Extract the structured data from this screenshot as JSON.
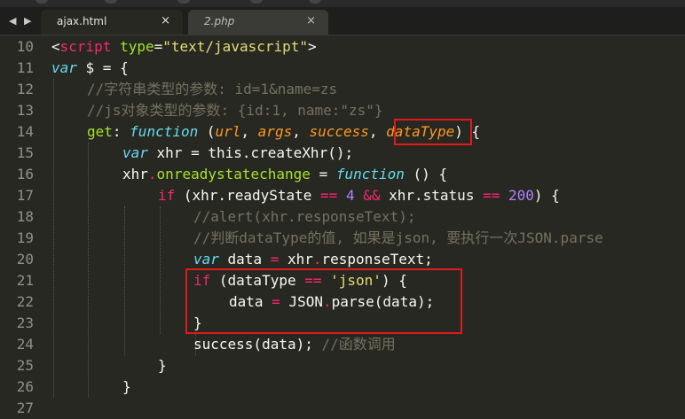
{
  "nav": {
    "back_icon": "◀",
    "forward_icon": "▶"
  },
  "tabs": [
    {
      "label": "ajax.html",
      "close": "×",
      "active": true
    },
    {
      "label": "2.php",
      "close": "×",
      "active": false
    }
  ],
  "line_numbers": [
    "10",
    "11",
    "12",
    "13",
    "14",
    "15",
    "16",
    "17",
    "18",
    "19",
    "20",
    "21",
    "22",
    "23",
    "24",
    "25",
    "26",
    "27"
  ],
  "code": {
    "l10": {
      "p1": "<",
      "tag": "script",
      "attr": "type",
      "p2": "=",
      "val": "\"text/javascript\"",
      "p3": ">"
    },
    "l11": {
      "var": "var",
      "rest": " $ = {"
    },
    "l12": {
      "comment": "//字符串类型的参数: id=1&name=zs"
    },
    "l13": {
      "comment": "//js对象类型的参数: {id:1, name:\"zs\"}"
    },
    "l14": {
      "key": "get",
      "colon": ": ",
      "func": "function",
      "open": " (",
      "a1": "url",
      "c1": ", ",
      "a2": "args",
      "c2": ", ",
      "a3": "success",
      "c3": ", ",
      "a4": "dataType",
      "close": ") {"
    },
    "l15": {
      "var": "var",
      "rest": " xhr = this.createXhr();"
    },
    "l16": {
      "obj": "xhr",
      "dot": ".",
      "prop": "onreadystatechange",
      "eq": " = ",
      "func": "function",
      "rest": " () {"
    },
    "l17": {
      "if": "if",
      "t1": " (xhr.readyState ",
      "op1": "==",
      "t2": " ",
      "num1": "4",
      "t3": " ",
      "op2": "&&",
      "t4": " xhr.status ",
      "op3": "==",
      "t5": " ",
      "num2": "200",
      "t6": ") {"
    },
    "l18": {
      "comment": "//alert(xhr.responseText);"
    },
    "l19": {
      "comment": "//判断dataType的值, 如果是json, 要执行一次JSON.parse"
    },
    "l20": {
      "var": "var",
      "t1": " data ",
      "op": "=",
      "t2": " xhr",
      "dot": ".",
      "rest": "responseText;"
    },
    "l21": {
      "if": "if",
      "t1": " (dataType ",
      "op": "==",
      "t2": " ",
      "str": "'json'",
      "t3": ") {"
    },
    "l22": {
      "t1": "data ",
      "op": "=",
      "t2": " JSON",
      "dot": ".",
      "rest": "parse(data);"
    },
    "l23": {
      "text": "}"
    },
    "l24": {
      "text": "success(data); ",
      "comment": "//函数调用"
    },
    "l25": {
      "text": "}"
    },
    "l26": {
      "text": "}"
    },
    "l27": {
      "text": ""
    }
  },
  "colors": {
    "background": "#272822",
    "highlight_box": "#e0191c"
  }
}
